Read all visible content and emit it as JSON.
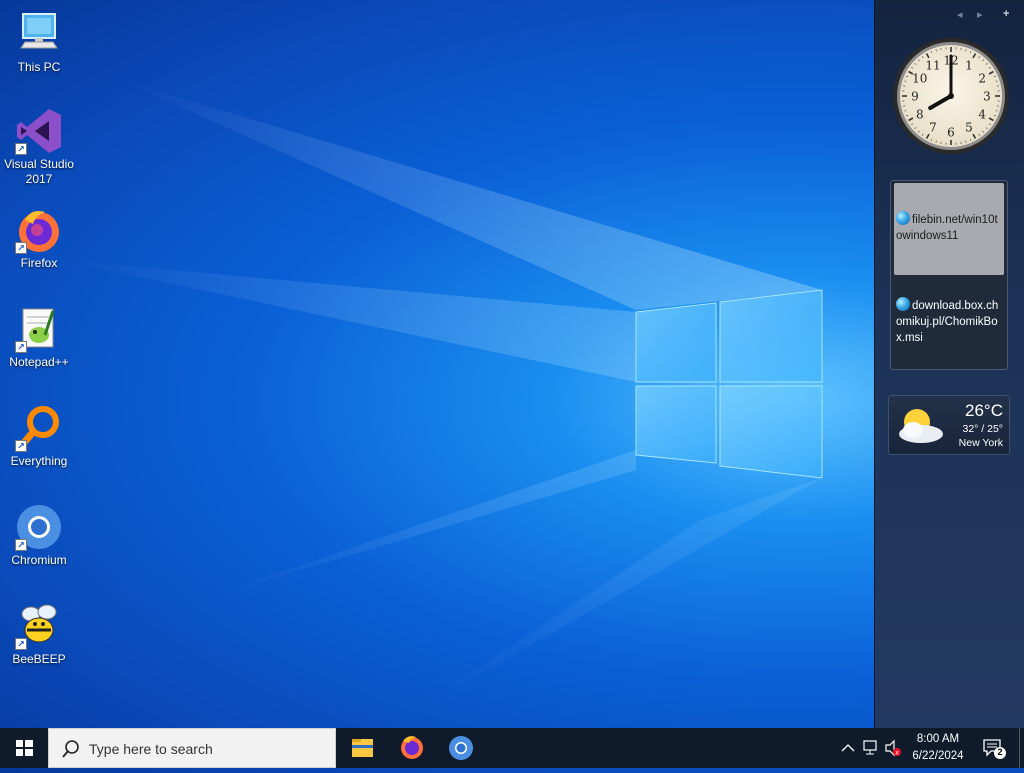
{
  "desktop": {
    "icons": [
      {
        "label": "This PC"
      },
      {
        "label": "Visual Studio\n2017"
      },
      {
        "label": "Firefox"
      },
      {
        "label": "Notepad++"
      },
      {
        "label": "Everything"
      },
      {
        "label": "Chromium"
      },
      {
        "label": "BeeBEEP"
      }
    ]
  },
  "sidebar": {
    "controls": {
      "prev": "◂",
      "next": "▸",
      "add": "+"
    },
    "clock": {
      "hour": 8,
      "minute": 0,
      "numbers": [
        "1",
        "2",
        "3",
        "4",
        "5",
        "6",
        "7",
        "8",
        "9",
        "10",
        "11",
        "12"
      ]
    },
    "feed": {
      "items": [
        {
          "text": "filebin.net/win10towindows11",
          "selected": true
        },
        {
          "text": "download.box.chomikuj.pl/ChomikBox.msi",
          "selected": false
        }
      ]
    },
    "weather": {
      "temp": "26°C",
      "range": "32° / 25°",
      "city": "New York"
    }
  },
  "taskbar": {
    "search_placeholder": "Type here to search",
    "time": "8:00 AM",
    "date": "6/22/2024",
    "notification_count": "2"
  },
  "colors": {
    "accent": "#0a5fd6",
    "taskbar": "#0f1a2a",
    "sidebar": "#1c3155"
  }
}
